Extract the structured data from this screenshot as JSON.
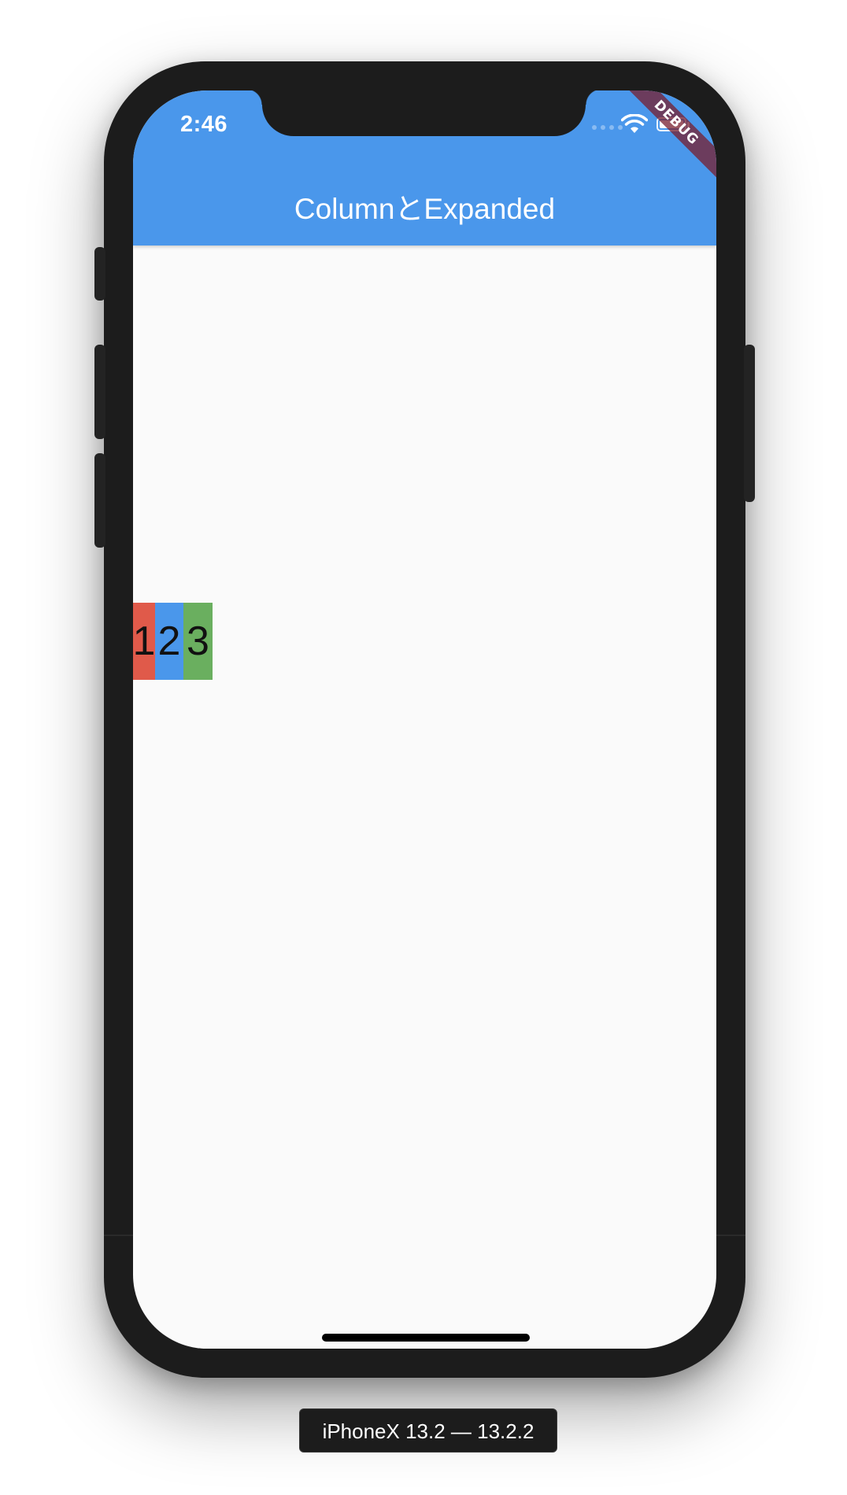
{
  "status_bar": {
    "time": "2:46",
    "debug_banner": "DEBUG"
  },
  "app_bar": {
    "title": "ColumnとExpanded",
    "color": "#4a97eb"
  },
  "row_items": [
    {
      "label": "1",
      "color": "#e05a4a"
    },
    {
      "label": "2",
      "color": "#4a97eb"
    },
    {
      "label": "3",
      "color": "#6aaf5f"
    }
  ],
  "device_label": "iPhoneX 13.2 — 13.2.2",
  "icons": {
    "wifi": "wifi-icon",
    "battery": "battery-icon",
    "signal": "signal-icon"
  }
}
